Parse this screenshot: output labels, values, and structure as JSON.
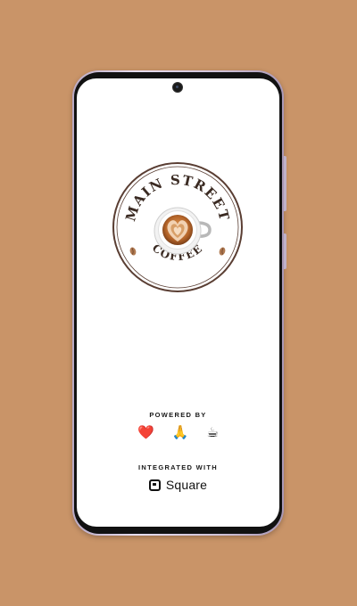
{
  "brand": {
    "top_text": "MAIN STREET",
    "bottom_text": "COFFEE",
    "accent_color": "#C99468",
    "ring_color": "#5a3e33"
  },
  "powered_by": {
    "label": "POWERED BY",
    "emojis": [
      "❤️",
      "🙏",
      "☕"
    ]
  },
  "integration": {
    "label": "INTEGRATED WITH",
    "partner": "Square",
    "icon": "square-logo-icon"
  }
}
